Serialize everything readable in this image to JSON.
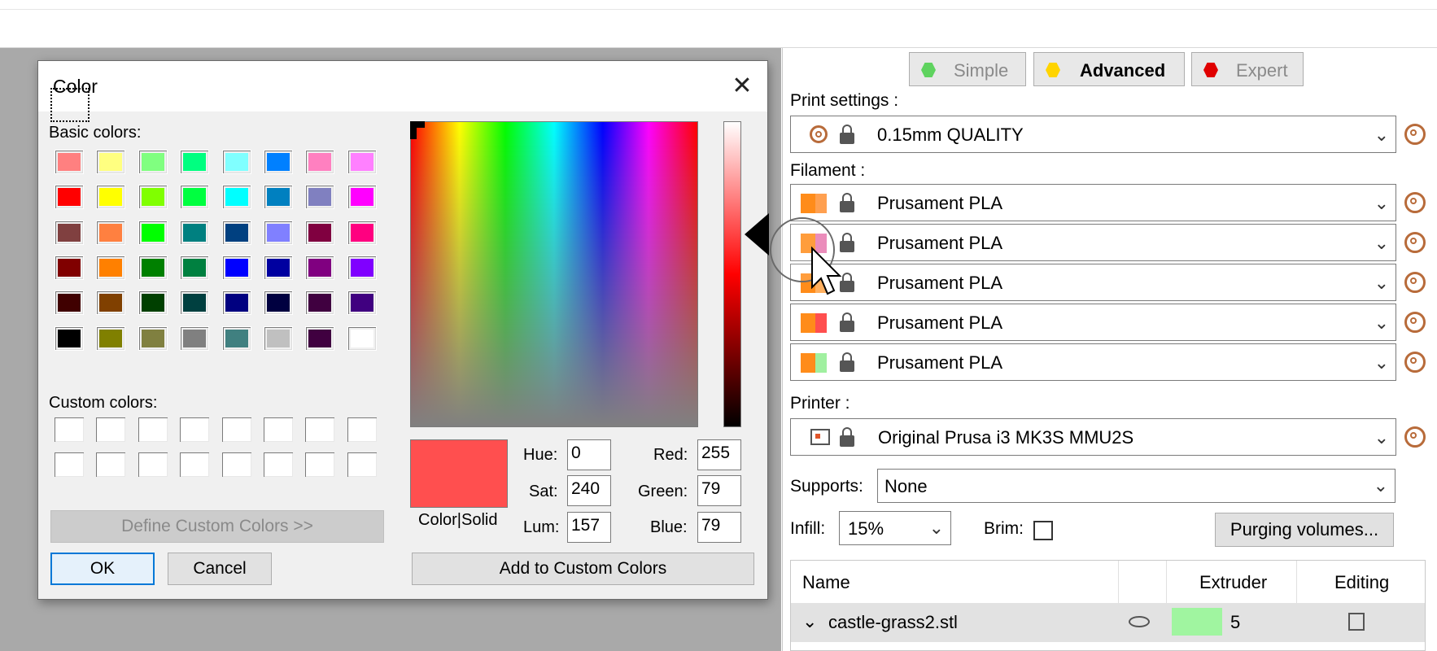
{
  "dialog": {
    "title": "Color",
    "close": "✕",
    "basic_colors_label": "Basic colors:",
    "custom_colors_label": "Custom colors:",
    "basic_colors": [
      "#ff8080",
      "#ffff80",
      "#80ff80",
      "#00ff80",
      "#80ffff",
      "#0080ff",
      "#ff80c0",
      "#ff80ff",
      "#ff0000",
      "#ffff00",
      "#80ff00",
      "#00ff40",
      "#00ffff",
      "#0080c0",
      "#8080c0",
      "#ff00ff",
      "#804040",
      "#ff8040",
      "#00ff00",
      "#008080",
      "#004080",
      "#8080ff",
      "#800040",
      "#ff0080",
      "#800000",
      "#ff8000",
      "#008000",
      "#008040",
      "#0000ff",
      "#0000a0",
      "#800080",
      "#8000ff",
      "#400000",
      "#804000",
      "#004000",
      "#004040",
      "#000080",
      "#000040",
      "#400040",
      "#400080",
      "#000000",
      "#808000",
      "#808040",
      "#808080",
      "#408080",
      "#c0c0c0",
      "#400040",
      "#ffffff"
    ],
    "define_custom_label": "Define Custom Colors >>",
    "ok_label": "OK",
    "cancel_label": "Cancel",
    "preview_color": "#ff4f4f",
    "color_solid_label": "Color|Solid",
    "hue_label": "Hue:",
    "hue": "0",
    "sat_label": "Sat:",
    "sat": "240",
    "lum_label": "Lum:",
    "lum": "157",
    "red_label": "Red:",
    "red": "255",
    "green_label": "Green:",
    "green": "79",
    "blue_label": "Blue:",
    "blue": "79",
    "add_custom_label": "Add to Custom Colors"
  },
  "modes": [
    {
      "label": "Simple",
      "color": "#5fd35f"
    },
    {
      "label": "Advanced",
      "color": "#ffd400"
    },
    {
      "label": "Expert",
      "color": "#e00000"
    }
  ],
  "print_settings": {
    "label": "Print settings :",
    "value": "0.15mm QUALITY"
  },
  "filament": {
    "label": "Filament :",
    "items": [
      {
        "value": "Prusament PLA",
        "color": "#ff8c1a",
        "color2": "#ffa050"
      },
      {
        "value": "Prusament PLA",
        "color": "#ff8c1a",
        "color2": "#e879b0"
      },
      {
        "value": "Prusament PLA",
        "color": "#ff8c1a",
        "color2": "#ffb060"
      },
      {
        "value": "Prusament PLA",
        "color": "#ff8c1a",
        "color2": "#ff4f4f"
      },
      {
        "value": "Prusament PLA",
        "color": "#ff8c1a",
        "color2": "#a0f0a0"
      }
    ]
  },
  "printer": {
    "label": "Printer :",
    "value": "Original Prusa i3 MK3S MMU2S"
  },
  "supports": {
    "label": "Supports:",
    "value": "None"
  },
  "infill": {
    "label": "Infill:",
    "value": "15%"
  },
  "brim": {
    "label": "Brim:"
  },
  "purging_label": "Purging volumes...",
  "table": {
    "headers": [
      "Name",
      "Extruder",
      "Editing"
    ],
    "rows": [
      {
        "name": "castle-grass2.stl",
        "extruder": "5",
        "color": "#a0f5a0"
      }
    ]
  }
}
